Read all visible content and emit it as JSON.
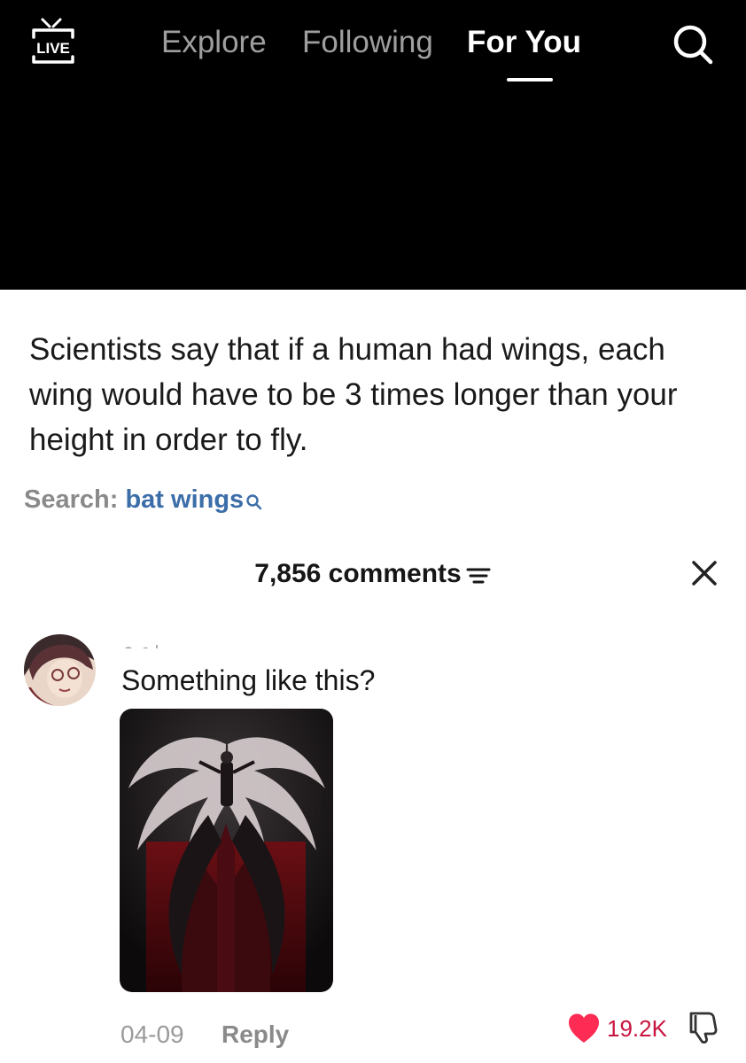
{
  "header": {
    "live_label": "LIVE",
    "tabs": [
      {
        "label": "Explore",
        "active": false
      },
      {
        "label": "Following",
        "active": false
      },
      {
        "label": "For You",
        "active": true
      }
    ],
    "search_icon": "search-icon"
  },
  "post": {
    "caption": "Scientists say that if a human had wings, each wing would have to be 3 times longer than your height in order to fly.",
    "search_label": "Search:",
    "search_term": "bat wings"
  },
  "comments": {
    "count_label": "7,856 comments",
    "sort_icon": "sort-icon",
    "close_icon": "close-icon",
    "items": [
      {
        "username": "",
        "text": "Something like this?",
        "date": "04-09",
        "reply_label": "Reply",
        "likes": "19.2K",
        "liked": true
      }
    ]
  },
  "colors": {
    "like": "#fe2c55",
    "like_count": "#c81540",
    "search_term": "#3b6ea8",
    "video_bg": "#000000"
  }
}
